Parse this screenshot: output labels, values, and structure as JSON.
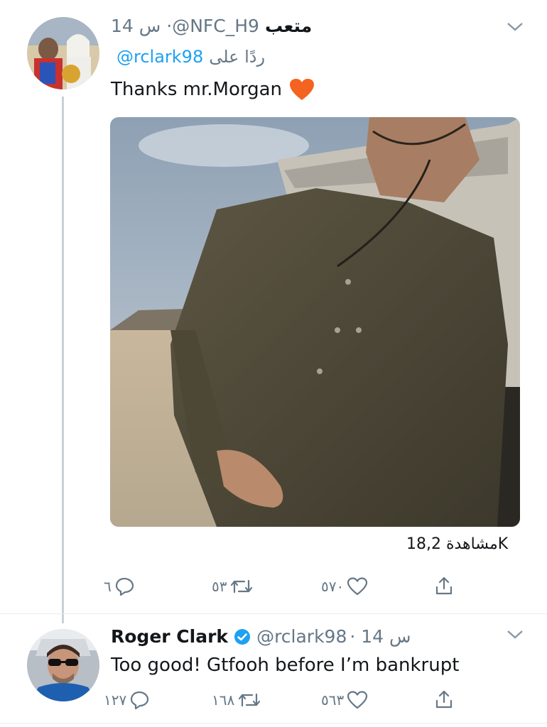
{
  "tweet1": {
    "name": "متعب",
    "handle": "@NFC_H9",
    "time": "14 س ·",
    "replying_label": "ردًا على",
    "replying_to": "@rclark98",
    "text": "Thanks mr.Morgan",
    "views": "مشاهدة 18,2K",
    "actions": {
      "reply_count": "٦",
      "retweet_count": "٥٣",
      "like_count": "٥٧٠"
    }
  },
  "tweet2": {
    "name": "Roger Clark",
    "handle": "@rclark98",
    "time": "· 14 س",
    "text": "Too good! Gtfooh before I’m bankrupt",
    "actions": {
      "reply_count": "١٢٧",
      "retweet_count": "١٦٨",
      "like_count": "٥٦٣"
    }
  },
  "icons": {
    "reply": "reply-icon",
    "retweet": "retweet-icon",
    "like": "like-icon",
    "share": "share-icon",
    "more": "chevron-down-icon",
    "verified": "verified-badge-icon",
    "heart_emoji": "orange-heart-emoji"
  },
  "colors": {
    "link": "#1da1f2",
    "muted": "#657786",
    "heart": "#f4631f"
  }
}
